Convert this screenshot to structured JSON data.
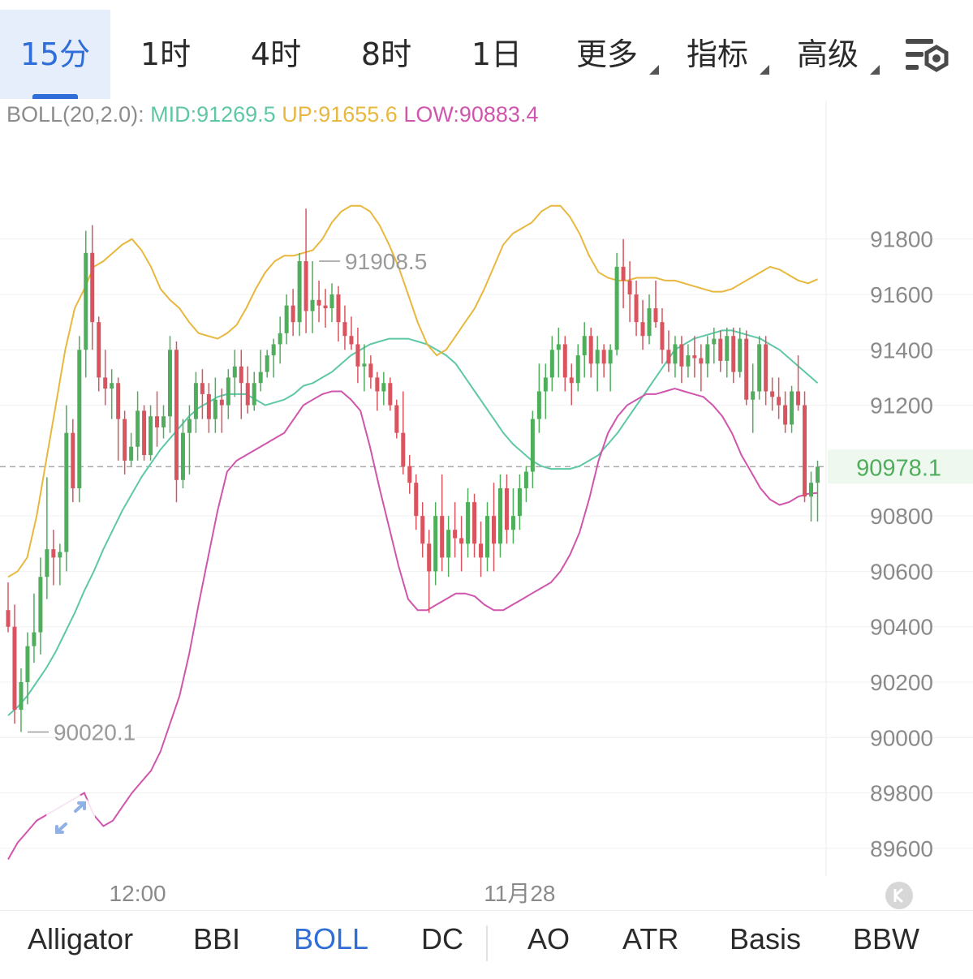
{
  "timeframe_tabs": [
    {
      "label": "15分",
      "active": true
    },
    {
      "label": "1时",
      "active": false
    },
    {
      "label": "4时",
      "active": false
    },
    {
      "label": "8时",
      "active": false
    },
    {
      "label": "1日",
      "active": false
    }
  ],
  "dropdown_tabs": [
    {
      "label": "更多"
    },
    {
      "label": "指标"
    },
    {
      "label": "高级"
    }
  ],
  "settings_icon": "chart-settings-icon",
  "legend": {
    "name": "BOLL(20,2.0):",
    "mid": "MID:91269.5",
    "up": "UP:91655.6",
    "low": "LOW:90883.4"
  },
  "colors": {
    "up_candle": "#4fae5c",
    "down_candle": "#d9545e",
    "mid_line": "#5ec8a6",
    "up_line": "#e8b83e",
    "low_line": "#cf55ad",
    "active_tab": "#2f6ed8"
  },
  "chart_data": {
    "type": "candlestick",
    "indicator": "BOLL(20,2.0)",
    "ylim": [
      89500,
      92300
    ],
    "y_ticks": [
      91800,
      91600,
      91400,
      91200,
      90800,
      90600,
      90400,
      90200,
      90000,
      89800,
      89600
    ],
    "current_price": "90978.1",
    "x_labels": [
      {
        "label": "12:00",
        "index": 20
      },
      {
        "label": "11月28",
        "index": 79
      }
    ],
    "annotations": [
      {
        "label": "91908.5",
        "index": 47
      },
      {
        "label": "90020.1",
        "index": 2
      }
    ],
    "candles": [
      [
        90460,
        90560,
        90380,
        90400
      ],
      [
        90400,
        90480,
        90050,
        90100
      ],
      [
        90100,
        90250,
        90020,
        90200
      ],
      [
        90200,
        90380,
        90120,
        90330
      ],
      [
        90330,
        90520,
        90270,
        90380
      ],
      [
        90380,
        90650,
        90300,
        90580
      ],
      [
        90580,
        90940,
        90500,
        90680
      ],
      [
        90680,
        90750,
        90550,
        90650
      ],
      [
        90650,
        90700,
        90550,
        90670
      ],
      [
        90670,
        91200,
        90600,
        91100
      ],
      [
        91100,
        91150,
        90850,
        90900
      ],
      [
        90900,
        91450,
        90850,
        91400
      ],
      [
        91400,
        91830,
        91300,
        91750
      ],
      [
        91750,
        91850,
        91400,
        91500
      ],
      [
        91500,
        91520,
        91250,
        91300
      ],
      [
        91300,
        91400,
        91200,
        91260
      ],
      [
        91260,
        91330,
        91150,
        91280
      ],
      [
        91280,
        91300,
        91000,
        91150
      ],
      [
        91150,
        91180,
        90950,
        91000
      ],
      [
        91000,
        91100,
        90980,
        91050
      ],
      [
        91050,
        91250,
        91000,
        91180
      ],
      [
        91180,
        91200,
        91000,
        91020
      ],
      [
        91020,
        91200,
        91000,
        91160
      ],
      [
        91160,
        91250,
        91050,
        91120
      ],
      [
        91120,
        91200,
        91080,
        91160
      ],
      [
        91160,
        91450,
        91100,
        91400
      ],
      [
        91400,
        91430,
        90850,
        90930
      ],
      [
        90930,
        91150,
        90900,
        91100
      ],
      [
        91100,
        91200,
        90950,
        91150
      ],
      [
        91150,
        91320,
        91100,
        91280
      ],
      [
        91280,
        91330,
        91150,
        91240
      ],
      [
        91240,
        91280,
        91100,
        91150
      ],
      [
        91150,
        91300,
        91100,
        91220
      ],
      [
        91220,
        91260,
        91100,
        91200
      ],
      [
        91200,
        91330,
        91150,
        91300
      ],
      [
        91300,
        91400,
        91230,
        91340
      ],
      [
        91340,
        91400,
        91150,
        91280
      ],
      [
        91280,
        91340,
        91170,
        91200
      ],
      [
        91200,
        91320,
        91180,
        91280
      ],
      [
        91280,
        91400,
        91250,
        91320
      ],
      [
        91320,
        91400,
        91300,
        91380
      ],
      [
        91380,
        91440,
        91300,
        91420
      ],
      [
        91420,
        91520,
        91350,
        91460
      ],
      [
        91460,
        91600,
        91420,
        91560
      ],
      [
        91560,
        91620,
        91450,
        91500
      ],
      [
        91500,
        91750,
        91450,
        91720
      ],
      [
        91720,
        91910,
        91460,
        91540
      ],
      [
        91540,
        91720,
        91460,
        91580
      ],
      [
        91580,
        91650,
        91500,
        91560
      ],
      [
        91560,
        91620,
        91480,
        91550
      ],
      [
        91550,
        91640,
        91500,
        91600
      ],
      [
        91600,
        91630,
        91430,
        91500
      ],
      [
        91500,
        91560,
        91400,
        91450
      ],
      [
        91450,
        91520,
        91400,
        91420
      ],
      [
        91420,
        91480,
        91280,
        91340
      ],
      [
        91340,
        91420,
        91250,
        91350
      ],
      [
        91350,
        91380,
        91260,
        91300
      ],
      [
        91300,
        91320,
        91180,
        91250
      ],
      [
        91250,
        91320,
        91200,
        91280
      ],
      [
        91280,
        91300,
        91180,
        91200
      ],
      [
        91200,
        91220,
        91080,
        91100
      ],
      [
        91100,
        91250,
        90950,
        90980
      ],
      [
        90980,
        91020,
        90880,
        90920
      ],
      [
        90920,
        90950,
        90750,
        90800
      ],
      [
        90800,
        90850,
        90650,
        90700
      ],
      [
        90700,
        90750,
        90450,
        90600
      ],
      [
        90600,
        90850,
        90550,
        90800
      ],
      [
        90800,
        90950,
        90600,
        90650
      ],
      [
        90650,
        90800,
        90580,
        90750
      ],
      [
        90750,
        90850,
        90650,
        90720
      ],
      [
        90720,
        90800,
        90600,
        90700
      ],
      [
        90700,
        90900,
        90650,
        90850
      ],
      [
        90850,
        90880,
        90650,
        90700
      ],
      [
        90700,
        90780,
        90580,
        90650
      ],
      [
        90650,
        90850,
        90600,
        90800
      ],
      [
        90800,
        90920,
        90600,
        90700
      ],
      [
        90700,
        90950,
        90650,
        90900
      ],
      [
        90900,
        90950,
        90700,
        90750
      ],
      [
        90750,
        90900,
        90700,
        90800
      ],
      [
        90800,
        90950,
        90750,
        90900
      ],
      [
        90900,
        90980,
        90850,
        90960
      ],
      [
        90960,
        91180,
        90900,
        91150
      ],
      [
        91150,
        91350,
        91100,
        91250
      ],
      [
        91250,
        91350,
        91150,
        91300
      ],
      [
        91300,
        91450,
        91250,
        91400
      ],
      [
        91400,
        91480,
        91300,
        91420
      ],
      [
        91420,
        91450,
        91250,
        91300
      ],
      [
        91300,
        91350,
        91200,
        91280
      ],
      [
        91280,
        91420,
        91250,
        91380
      ],
      [
        91380,
        91500,
        91300,
        91450
      ],
      [
        91450,
        91480,
        91300,
        91350
      ],
      [
        91350,
        91450,
        91250,
        91400
      ],
      [
        91400,
        91420,
        91300,
        91350
      ],
      [
        91350,
        91420,
        91250,
        91400
      ],
      [
        91400,
        91750,
        91380,
        91700
      ],
      [
        91700,
        91800,
        91550,
        91650
      ],
      [
        91650,
        91720,
        91500,
        91600
      ],
      [
        91600,
        91650,
        91450,
        91500
      ],
      [
        91500,
        91580,
        91400,
        91450
      ],
      [
        91450,
        91600,
        91420,
        91550
      ],
      [
        91550,
        91650,
        91480,
        91500
      ],
      [
        91500,
        91550,
        91350,
        91400
      ],
      [
        91400,
        91470,
        91320,
        91350
      ],
      [
        91350,
        91450,
        91300,
        91420
      ],
      [
        91420,
        91450,
        91280,
        91340
      ],
      [
        91340,
        91420,
        91300,
        91380
      ],
      [
        91380,
        91450,
        91300,
        91370
      ],
      [
        91370,
        91420,
        91250,
        91350
      ],
      [
        91350,
        91450,
        91300,
        91420
      ],
      [
        91420,
        91480,
        91350,
        91440
      ],
      [
        91440,
        91470,
        91320,
        91360
      ],
      [
        91360,
        91480,
        91300,
        91450
      ],
      [
        91450,
        91480,
        91280,
        91320
      ],
      [
        91320,
        91480,
        91300,
        91440
      ],
      [
        91440,
        91470,
        91200,
        91220
      ],
      [
        91220,
        91350,
        91100,
        91250
      ],
      [
        91250,
        91450,
        91220,
        91420
      ],
      [
        91420,
        91450,
        91200,
        91250
      ],
      [
        91250,
        91300,
        91180,
        91230
      ],
      [
        91230,
        91300,
        91150,
        91200
      ],
      [
        91200,
        91250,
        91100,
        91130
      ],
      [
        91130,
        91270,
        91100,
        91250
      ],
      [
        91250,
        91380,
        91180,
        91200
      ],
      [
        91200,
        91250,
        90850,
        90870
      ],
      [
        90870,
        90960,
        90780,
        90920
      ],
      [
        90920,
        91000,
        90780,
        90978
      ]
    ],
    "series": [
      {
        "name": "MID",
        "values": [
          90080,
          90110,
          90150,
          90200,
          90250,
          90310,
          90380,
          90450,
          90530,
          90600,
          90680,
          90750,
          90820,
          90880,
          90940,
          90990,
          91040,
          91080,
          91120,
          91160,
          91190,
          91210,
          91230,
          91240,
          91240,
          91240,
          91220,
          91200,
          91210,
          91220,
          91240,
          91270,
          91280,
          91300,
          91320,
          91350,
          91380,
          91400,
          91420,
          91430,
          91440,
          91440,
          91440,
          91430,
          91420,
          91400,
          91380,
          91350,
          91300,
          91250,
          91200,
          91150,
          91100,
          91060,
          91030,
          91000,
          90980,
          90970,
          90970,
          90970,
          90980,
          91000,
          91020,
          91060,
          91100,
          91150,
          91200,
          91250,
          91300,
          91350,
          91400,
          91420,
          91440,
          91450,
          91460,
          91470,
          91470,
          91460,
          91450,
          91440,
          91420,
          91400,
          91370,
          91340,
          91310,
          91280
        ]
      },
      {
        "name": "UP",
        "values": [
          90580,
          90600,
          90650,
          90800,
          91000,
          91200,
          91400,
          91550,
          91620,
          91700,
          91720,
          91750,
          91780,
          91800,
          91760,
          91700,
          91620,
          91580,
          91550,
          91500,
          91460,
          91450,
          91440,
          91460,
          91490,
          91550,
          91620,
          91680,
          91720,
          91740,
          91740,
          91750,
          91760,
          91800,
          91860,
          91900,
          91920,
          91920,
          91900,
          91850,
          91780,
          91700,
          91600,
          91500,
          91420,
          91380,
          91400,
          91450,
          91500,
          91550,
          91620,
          91700,
          91780,
          91820,
          91840,
          91860,
          91900,
          91920,
          91920,
          91880,
          91820,
          91740,
          91680,
          91660,
          91650,
          91650,
          91660,
          91660,
          91660,
          91650,
          91650,
          91640,
          91630,
          91620,
          91610,
          91610,
          91620,
          91640,
          91660,
          91680,
          91700,
          91690,
          91670,
          91650,
          91640,
          91655
        ]
      },
      {
        "name": "LOW",
        "values": [
          89560,
          89620,
          89660,
          89700,
          89720,
          89740,
          89760,
          89780,
          89800,
          89720,
          89680,
          89700,
          89750,
          89800,
          89840,
          89880,
          89950,
          90050,
          90150,
          90300,
          90480,
          90650,
          90820,
          90960,
          91000,
          91020,
          91040,
          91060,
          91080,
          91100,
          91150,
          91200,
          91220,
          91240,
          91250,
          91250,
          91220,
          91180,
          91050,
          90900,
          90760,
          90620,
          90500,
          90460,
          90460,
          90480,
          90500,
          90520,
          90520,
          90510,
          90480,
          90460,
          90460,
          90480,
          90500,
          90520,
          90540,
          90560,
          90600,
          90660,
          90740,
          90860,
          91000,
          91100,
          91160,
          91200,
          91220,
          91240,
          91240,
          91250,
          91260,
          91250,
          91240,
          91230,
          91200,
          91160,
          91100,
          91020,
          90960,
          90900,
          90860,
          90840,
          90850,
          90870,
          90880,
          90883
        ]
      }
    ]
  },
  "bottom_tabs": [
    {
      "label": "Alligator",
      "active": false
    },
    {
      "label": "BBI",
      "active": false
    },
    {
      "label": "BOLL",
      "active": true
    },
    {
      "label": "DC",
      "active": false
    },
    {
      "label": "AO",
      "active": false
    },
    {
      "label": "ATR",
      "active": false
    },
    {
      "label": "Basis",
      "active": false
    },
    {
      "label": "BBW",
      "active": false
    }
  ],
  "collapse_icon": "collapse-k-icon",
  "expand_icon": "expand-arrows-icon"
}
